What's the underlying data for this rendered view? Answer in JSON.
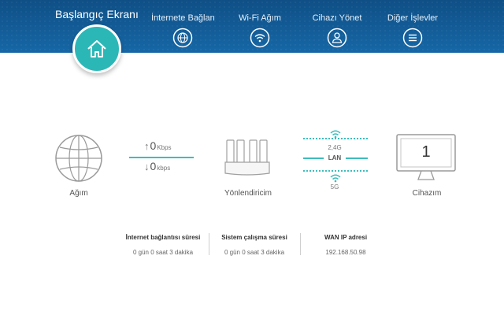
{
  "header": {
    "home_label": "Başlangıç Ekranı",
    "nav": [
      {
        "label": "İnternete Bağlan",
        "icon": "globe-icon"
      },
      {
        "label": "Wi-Fi Ağım",
        "icon": "wifi-icon"
      },
      {
        "label": "Cihazı Yönet",
        "icon": "user-icon"
      },
      {
        "label": "Diğer İşlevler",
        "icon": "menu-icon"
      }
    ]
  },
  "diagram": {
    "network_label": "Ağım",
    "upload_value": "0",
    "upload_unit": "Kbps",
    "download_value": "0",
    "download_unit": "kbps",
    "router_label": "Yönlendiricim",
    "band_24": "2,4G",
    "band_lan": "LAN",
    "band_5": "5G",
    "device_count": "1",
    "devices_label": "Cihazım"
  },
  "stats": [
    {
      "title": "İnternet bağlantısı süresi",
      "value": "0 gün 0 saat 3 dakika"
    },
    {
      "title": "Sistem çalışma süresi",
      "value": "0 gün 0 saat 3 dakika"
    },
    {
      "title": "WAN IP adresi",
      "value": "192.168.50.98"
    }
  ],
  "colors": {
    "header": "#1667a6",
    "accent": "#2cb7b7"
  }
}
